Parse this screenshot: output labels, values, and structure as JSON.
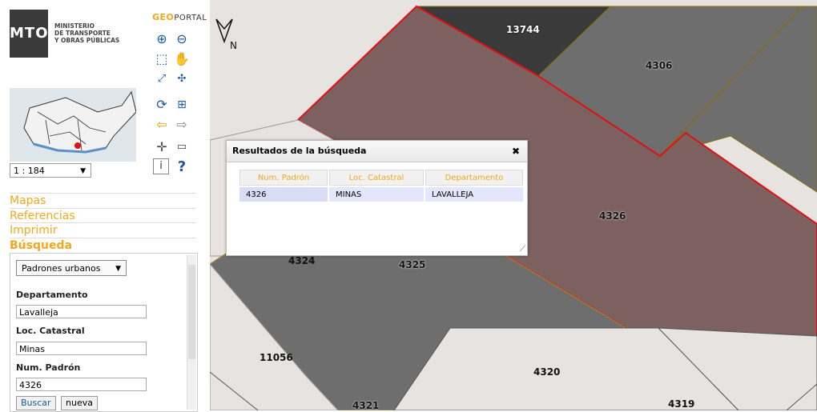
{
  "header": {
    "logo_text": "MTOP",
    "ministry_line1": "MINISTERIO",
    "ministry_line2": "DE TRANSPORTE",
    "ministry_line3": "Y OBRAS PÚBLICAS",
    "geoportal_prefix": "GEO",
    "geoportal_suffix": "PORTAL"
  },
  "scale": {
    "value": "1 : 184"
  },
  "menu": [
    {
      "label": "Mapas"
    },
    {
      "label": "Referencias"
    },
    {
      "label": "Imprimir"
    },
    {
      "label": "Búsqueda"
    }
  ],
  "search": {
    "type": "Padrones urbanos",
    "departamento_label": "Departamento",
    "departamento_value": "Lavalleja",
    "loc_label": "Loc. Catastral",
    "loc_value": "Minas",
    "padron_label": "Num. Padrón",
    "padron_value": "4326",
    "buscar": "Buscar",
    "nueva": "nueva"
  },
  "map": {
    "north": "N",
    "parcels": [
      "13744",
      "4306",
      "4326",
      "4324",
      "4325",
      "11056",
      "4320",
      "4319",
      "4321"
    ],
    "colors": {
      "highlight": "#7d6161",
      "dark": "#3a3a3a",
      "mid": "#6e6e6e",
      "light": "#e7e3e1",
      "selected_border": "#e01010"
    }
  },
  "results": {
    "title": "Resultados de la búsqueda",
    "columns": [
      "Num. Padrón",
      "Loc. Catastral",
      "Departamento"
    ],
    "rows": [
      [
        "4326",
        "MINAS",
        "LAVALLEJA"
      ]
    ]
  }
}
